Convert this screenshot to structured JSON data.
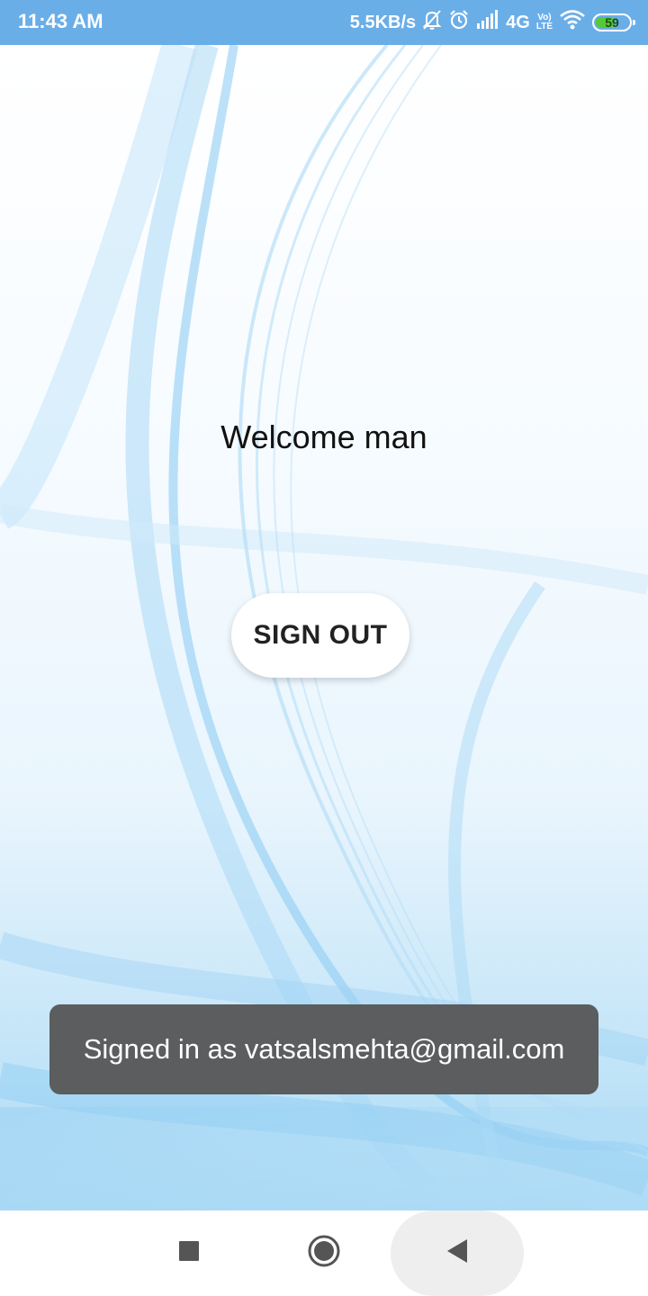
{
  "status_bar": {
    "time": "11:43 AM",
    "net_speed": "5.5KB/s",
    "net_type": "4G",
    "volte_top": "Vo)",
    "volte_bottom": "LTE",
    "battery_level": "59",
    "battery_fraction": 0.59,
    "icons": [
      "mute-bell-icon",
      "alarm-icon",
      "signal-icon",
      "wifi-icon",
      "battery-icon"
    ]
  },
  "main": {
    "welcome_text": "Welcome man",
    "signout_label": "SIGN OUT"
  },
  "toast": {
    "message": "Signed in as vatsalsmehta@gmail.com"
  },
  "nav_bar": {
    "icons": [
      "recents-square-icon",
      "home-circle-icon",
      "back-triangle-icon"
    ]
  },
  "colors": {
    "status_bar": "#6aaee8",
    "battery_fill": "#57c936",
    "toast_bg": "#5b5d5e",
    "background_accent": "#a6d8f4"
  }
}
